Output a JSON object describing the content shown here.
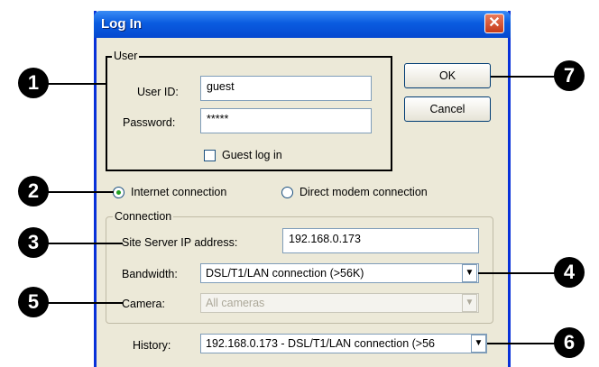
{
  "window": {
    "title": "Log In",
    "close_glyph": "✕"
  },
  "user_group": {
    "legend": "User",
    "user_id_label": "User ID:",
    "user_id_value": "guest",
    "password_label": "Password:",
    "password_value": "*****",
    "guest_label": "Guest log in"
  },
  "buttons": {
    "ok": "OK",
    "cancel": "Cancel"
  },
  "connection_type": {
    "internet_label": "Internet connection",
    "modem_label": "Direct modem connection",
    "selected": "internet"
  },
  "connection_group": {
    "legend": "Connection",
    "ip_label": "Site Server IP address:",
    "ip_value": "192.168.0.173",
    "bandwidth_label": "Bandwidth:",
    "bandwidth_value": "DSL/T1/LAN connection (>56K)",
    "camera_label": "Camera:",
    "camera_value": "All cameras"
  },
  "history": {
    "label": "History:",
    "value": "192.168.0.173 - DSL/T1/LAN connection (>56"
  },
  "callouts": [
    "1",
    "2",
    "3",
    "4",
    "5",
    "6",
    "7"
  ],
  "icons": {
    "dropdown_arrow": "▼"
  }
}
